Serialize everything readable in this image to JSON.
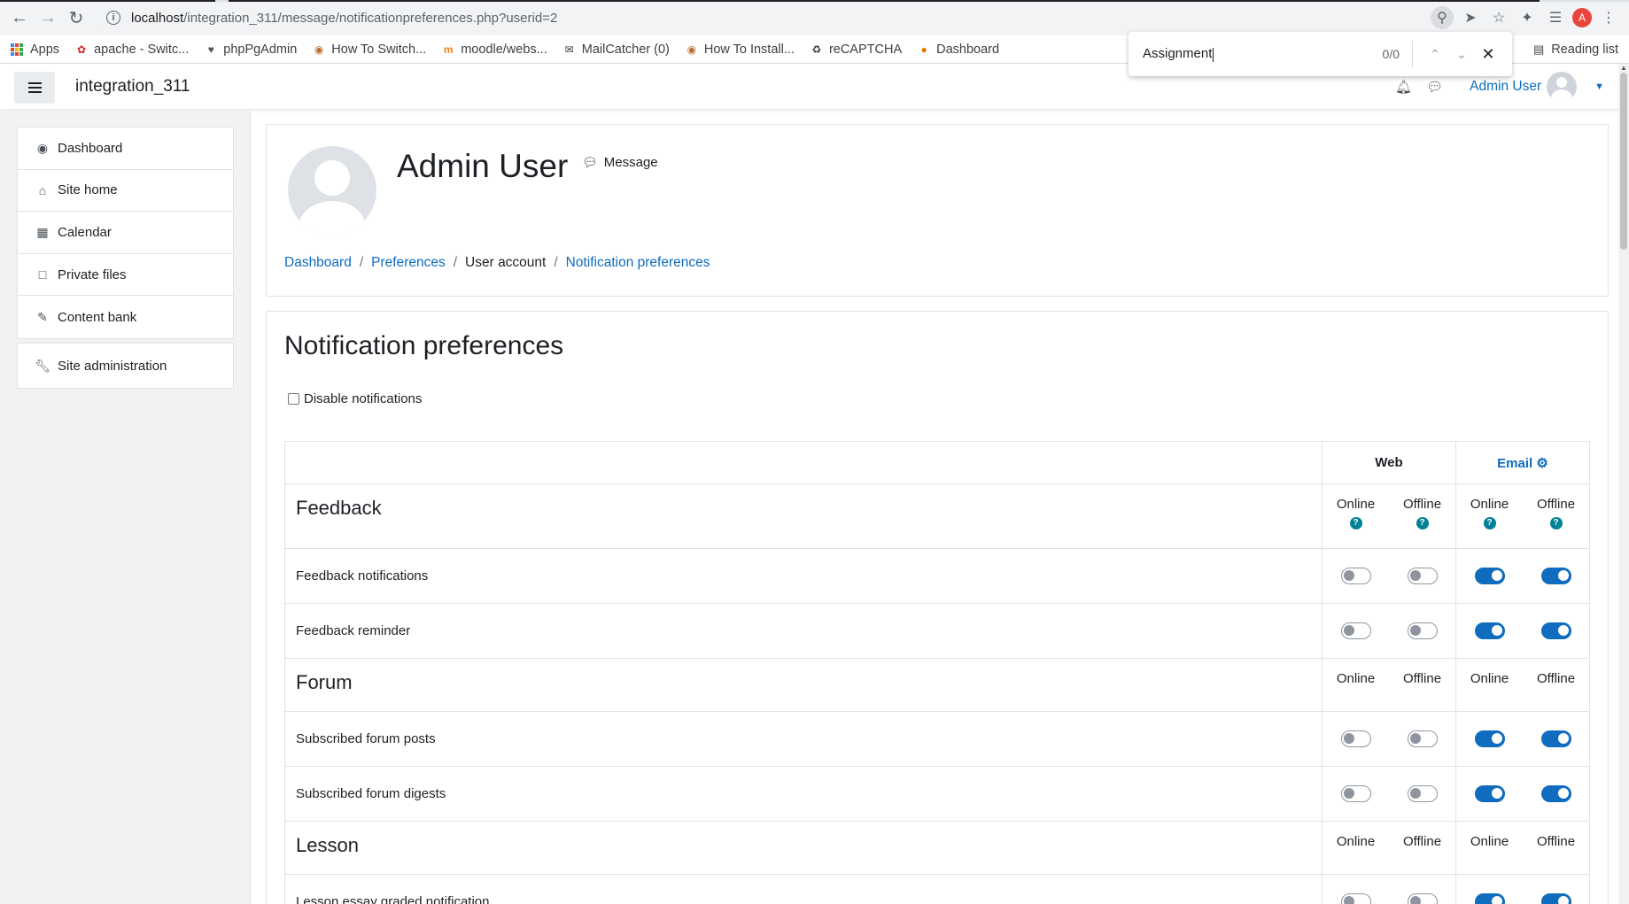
{
  "browser": {
    "url_host": "localhost",
    "url_path": "/integration_311/message/notificationpreferences.php?userid=2",
    "profile_initial": "A",
    "bookmarks": [
      {
        "label": "Apps",
        "icon": "apps-grid-icon"
      },
      {
        "label": "apache - Switc...",
        "icon": "apache-icon"
      },
      {
        "label": "phpPgAdmin",
        "icon": "elephant-icon"
      },
      {
        "label": "How To Switch...",
        "icon": "site-icon"
      },
      {
        "label": "moodle/webs...",
        "icon": "moodle-icon"
      },
      {
        "label": "MailCatcher (0)",
        "icon": "mail-icon"
      },
      {
        "label": "How To Install...",
        "icon": "site-icon"
      },
      {
        "label": "reCAPTCHA",
        "icon": "recaptcha-icon"
      },
      {
        "label": "Dashboard",
        "icon": "dashboard-icon"
      }
    ],
    "reading_list": "Reading list",
    "find": {
      "query": "Assignment",
      "count": "0/0"
    }
  },
  "navbar": {
    "site_name": "integration_311",
    "user_name": "Admin User"
  },
  "sidebar": {
    "items": [
      {
        "label": "Dashboard",
        "icon": "tachometer-icon"
      },
      {
        "label": "Site home",
        "icon": "home-icon"
      },
      {
        "label": "Calendar",
        "icon": "calendar-icon"
      },
      {
        "label": "Private files",
        "icon": "file-icon"
      },
      {
        "label": "Content bank",
        "icon": "paintbrush-icon"
      }
    ],
    "admin": {
      "label": "Site administration",
      "icon": "wrench-icon"
    }
  },
  "header": {
    "name": "Admin User",
    "message": "Message",
    "breadcrumb": [
      {
        "label": "Dashboard",
        "link": true
      },
      {
        "label": "Preferences",
        "link": true
      },
      {
        "label": "User account",
        "link": false
      },
      {
        "label": "Notification preferences",
        "link": true
      }
    ]
  },
  "prefs": {
    "title": "Notification preferences",
    "disable_label": "Disable notifications",
    "disable_checked": false,
    "processors": [
      {
        "label": "Web"
      },
      {
        "label": "Email"
      }
    ],
    "state_labels": {
      "online": "Online",
      "offline": "Offline"
    },
    "sections": [
      {
        "name": "Feedback",
        "help": true,
        "rows": [
          {
            "label": "Feedback notifications",
            "states": [
              false,
              false,
              true,
              true
            ]
          },
          {
            "label": "Feedback reminder",
            "states": [
              false,
              false,
              true,
              true
            ]
          }
        ]
      },
      {
        "name": "Forum",
        "help": false,
        "rows": [
          {
            "label": "Subscribed forum posts",
            "states": [
              false,
              false,
              true,
              true
            ]
          },
          {
            "label": "Subscribed forum digests",
            "states": [
              false,
              false,
              true,
              true
            ]
          }
        ]
      },
      {
        "name": "Lesson",
        "help": false,
        "rows": [
          {
            "label": "Lesson essay graded notification",
            "states": [
              false,
              false,
              true,
              true
            ]
          }
        ]
      }
    ]
  },
  "colors": {
    "brand": "#0f6cbf",
    "help": "#008196",
    "toggle_off": "#8f959e"
  }
}
